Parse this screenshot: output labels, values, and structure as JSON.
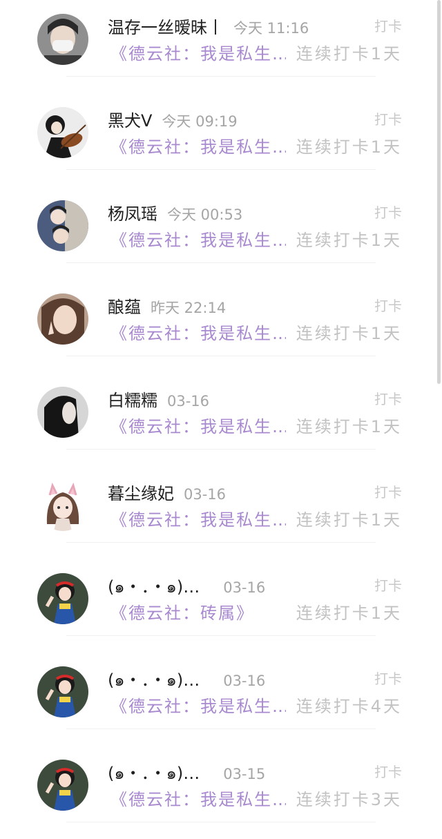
{
  "rows": [
    {
      "name": "温存一丝暧昧丨",
      "time": "今天 11:16",
      "action": "打卡",
      "title": "《德云社：我是私生…",
      "streak": "连续打卡1天",
      "avatar": "user-photo-masked",
      "bg": "#9a9a9a"
    },
    {
      "name": "黑犬V",
      "time": "今天 09:19",
      "action": "打卡",
      "title": "《德云社：我是私生…",
      "streak": "连续打卡1天",
      "avatar": "violinist-illustration",
      "bg": "#1c1c1c"
    },
    {
      "name": "杨凤瑶",
      "time": "今天 00:53",
      "action": "打卡",
      "title": "《德云社：我是私生…",
      "streak": "连续打卡1天",
      "avatar": "two-people-photo",
      "bg": "#4a5a7a"
    },
    {
      "name": "酿蕴",
      "time": "昨天 22:14",
      "action": "打卡",
      "title": "《德云社：我是私生…",
      "streak": "连续打卡1天",
      "avatar": "selfie-peace-sign",
      "bg": "#b59a88"
    },
    {
      "name": "白糯糯",
      "time": "03-16",
      "action": "打卡",
      "title": "《德云社：我是私生…",
      "streak": "连续打卡1天",
      "avatar": "dark-hair-profile",
      "bg": "#cfcfcf"
    },
    {
      "name": "暮尘缘妃",
      "time": "03-16",
      "action": "打卡",
      "title": "《德云社：我是私生…",
      "streak": "连续打卡1天",
      "avatar": "anime-cat-girl",
      "bg": "#ffffff"
    },
    {
      "name": "(๑・．・๑)…",
      "time": "03-16",
      "action": "打卡",
      "title": "《德云社：砖属》",
      "streak": "连续打卡1天",
      "avatar": "snow-white",
      "bg": "#3b4a3a"
    },
    {
      "name": "(๑・．・๑)…",
      "time": "03-16",
      "action": "打卡",
      "title": "《德云社：我是私生…",
      "streak": "连续打卡4天",
      "avatar": "snow-white",
      "bg": "#3b4a3a"
    },
    {
      "name": "(๑・．・๑)…",
      "time": "03-15",
      "action": "打卡",
      "title": "《德云社：我是私生…",
      "streak": "连续打卡3天",
      "avatar": "snow-white",
      "bg": "#3b4a3a"
    }
  ]
}
